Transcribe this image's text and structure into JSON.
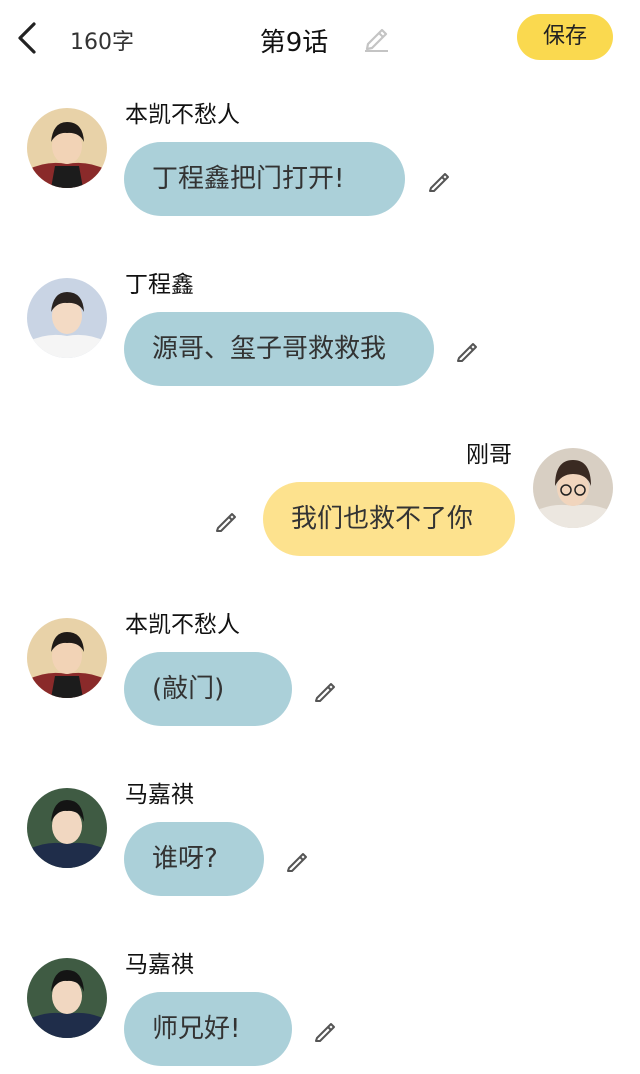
{
  "header": {
    "back_icon": "chevron-left-icon",
    "word_count": "160字",
    "title": "第9话",
    "edit_icon": "pencil-icon",
    "save_label": "保存",
    "save_color": "#fad94f"
  },
  "messages": [
    {
      "name": "本凯不愁人",
      "text": "丁程鑫把门打开!",
      "side": "left",
      "bubble_color": "#abd0d9"
    },
    {
      "name": "丁程鑫",
      "text": "源哥、玺子哥救救我",
      "side": "left",
      "bubble_color": "#abd0d9"
    },
    {
      "name": "刚哥",
      "text": "我们也救不了你",
      "side": "right",
      "bubble_color": "#fde28e"
    },
    {
      "name": "本凯不愁人",
      "text": "(敲门)",
      "side": "left",
      "bubble_color": "#abd0d9"
    },
    {
      "name": "马嘉祺",
      "text": "谁呀?",
      "side": "left",
      "bubble_color": "#abd0d9"
    },
    {
      "name": "马嘉祺",
      "text": "师兄好!",
      "side": "left",
      "bubble_color": "#abd0d9"
    }
  ]
}
